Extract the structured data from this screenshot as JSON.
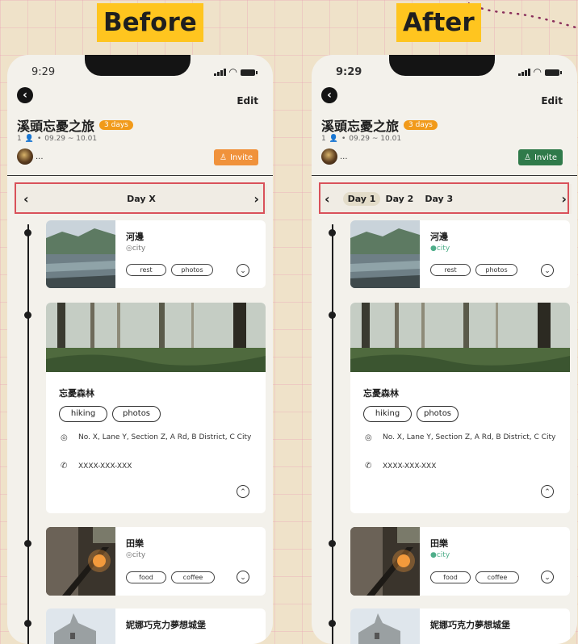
{
  "panels": {
    "before": {
      "heading": "Before",
      "accent": "#f0923b"
    },
    "after": {
      "heading": "After",
      "accent": "#2f7a4a"
    }
  },
  "status": {
    "time": "9:29"
  },
  "header": {
    "back_icon": "back-arrow-icon",
    "edit_label": "Edit"
  },
  "trip": {
    "title": "溪頭忘憂之旅",
    "days_badge": "3 days",
    "people_count": "1",
    "dot": "•",
    "dates": "09.29 ~ 10.01",
    "more": "...",
    "invite_label": "Invite"
  },
  "day_nav": {
    "before_label": "Day X",
    "prev_icon": "chevron-left-icon",
    "next_icon": "chevron-right-icon",
    "days": [
      "Day 1",
      "Day 2",
      "Day 3"
    ],
    "selected_day": "Day 1"
  },
  "places": [
    {
      "name": "河邊",
      "city": "city",
      "tags": [
        "rest",
        "photos"
      ],
      "expanded": false
    },
    {
      "name": "忘憂森林",
      "tags": [
        "hiking",
        "photos"
      ],
      "address": "No. X, Lane Y, Section Z, A Rd, B District, C City",
      "phone": "XXXX-XXX-XXX",
      "expanded": true
    },
    {
      "name": "田樂",
      "city": "city",
      "tags": [
        "food",
        "coffee"
      ],
      "expanded": false
    },
    {
      "name": "妮娜巧克力夢想城堡"
    }
  ],
  "colors": {
    "highlight": "#d9515a",
    "day_pill": "#e3dcc9",
    "after_pin": "#4fae8a",
    "before_pin": "#777777"
  }
}
